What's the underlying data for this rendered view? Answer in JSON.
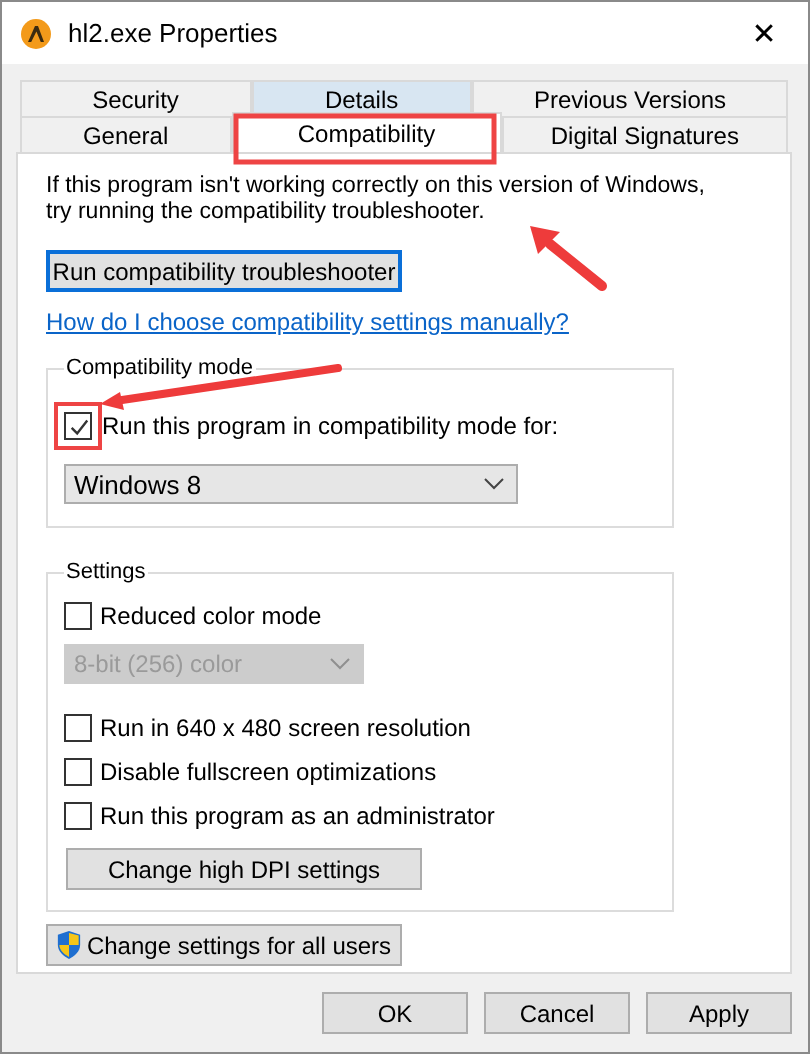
{
  "window": {
    "title": "hl2.exe Properties",
    "close": "✕"
  },
  "tab_rows": [
    [
      {
        "label": "Security",
        "selected": false,
        "hovered": false
      },
      {
        "label": "Details",
        "selected": false,
        "hovered": true
      },
      {
        "label": "Previous Versions",
        "selected": false,
        "hovered": false
      }
    ],
    [
      {
        "label": "General",
        "selected": false,
        "hovered": false
      },
      {
        "label": "Compatibility",
        "selected": true,
        "hovered": false
      },
      {
        "label": "Digital Signatures",
        "selected": false,
        "hovered": false
      }
    ]
  ],
  "intro": "If this program isn't working correctly on this version of Windows, try running the compatibility troubleshooter.",
  "troubleshooter_button": {
    "label": "Run compatibility troubleshooter",
    "focused": true
  },
  "help_link": "How do I choose compatibility settings manually?",
  "compatibility_mode": {
    "legend": "Compatibility mode",
    "checkbox": {
      "label": "Run this program in compatibility mode for:",
      "checked": true
    },
    "dropdown": {
      "value": "Windows 8",
      "disabled": false
    }
  },
  "settings": {
    "legend": "Settings",
    "items": [
      {
        "kind": "checkbox",
        "label": "Reduced color mode",
        "checked": false
      },
      {
        "kind": "dropdown",
        "value": "8-bit (256) color",
        "disabled": true
      },
      {
        "kind": "checkbox",
        "label": "Run in 640 x 480 screen resolution",
        "checked": false
      },
      {
        "kind": "checkbox",
        "label": "Disable fullscreen optimizations",
        "checked": false
      },
      {
        "kind": "checkbox",
        "label": "Run this program as an administrator",
        "checked": false
      },
      {
        "kind": "button",
        "label": "Change high DPI settings"
      }
    ]
  },
  "all_users_button": {
    "label": "Change settings for all users"
  },
  "footer_buttons": [
    "OK",
    "Cancel",
    "Apply"
  ]
}
